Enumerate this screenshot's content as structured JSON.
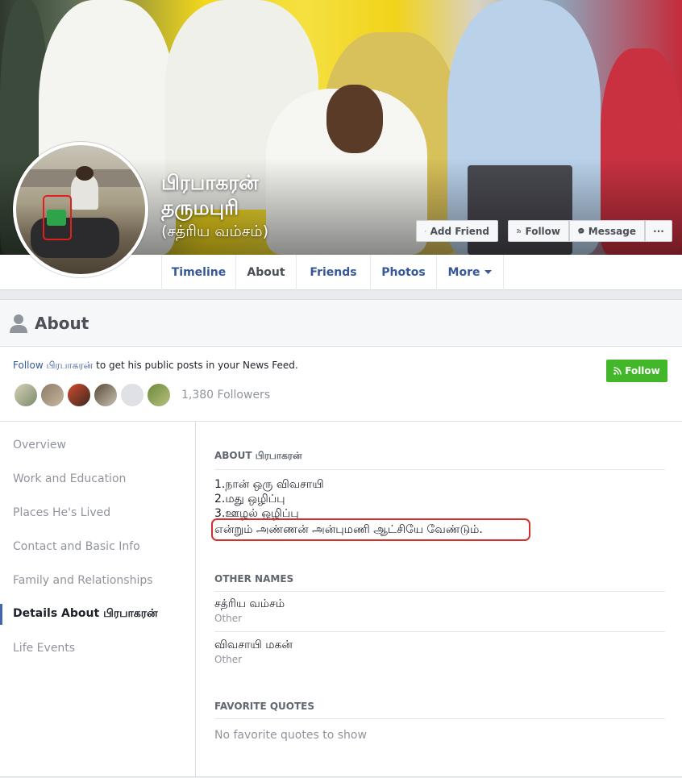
{
  "profile": {
    "name_line1": "பிரபாகரன்",
    "name_line2": "தருமபுரி",
    "name_line3": "(சத்ரிய வம்சம்)"
  },
  "cover_buttons": {
    "add_friend": "Add Friend",
    "follow": "Follow",
    "message": "Message",
    "more": "···"
  },
  "tabs": [
    {
      "label": "Timeline"
    },
    {
      "label": "About"
    },
    {
      "label": "Friends"
    },
    {
      "label": "Photos"
    },
    {
      "label": "More"
    }
  ],
  "about_header": {
    "title": "About",
    "follow_link": "Follow பிரபாகரன்",
    "follow_suffix": " to get his public posts in your News Feed.",
    "follow_button": "Follow",
    "followers": "1,380 Followers"
  },
  "sidebar": {
    "items": [
      {
        "label": "Overview"
      },
      {
        "label": "Work and Education"
      },
      {
        "label": "Places He's Lived"
      },
      {
        "label": "Contact and Basic Info"
      },
      {
        "label": "Family and Relationships"
      },
      {
        "label": "Details About பிரபாகரன்"
      },
      {
        "label": "Life Events"
      }
    ]
  },
  "about_section": {
    "heading": "ABOUT பிரபாகரன்",
    "lines": [
      "1.நான் ஒரு விவசாயி",
      "2.மது ஒழிப்பு",
      "3.ஊழல் ஒழிப்பு",
      "என்றும் அண்ணன் அன்புமணி ஆட்சியே வேண்டும்."
    ]
  },
  "other_names": {
    "heading": "OTHER NAMES",
    "items": [
      {
        "name": "சத்ரிய வம்சம்",
        "type": "Other"
      },
      {
        "name": "விவசாயி மகன்",
        "type": "Other"
      }
    ]
  },
  "favorite_quotes": {
    "heading": "FAVORITE QUOTES",
    "empty": "No favorite quotes to show"
  },
  "colors": {
    "link": "#365899",
    "green": "#42b72a",
    "highlight": "#d3302b"
  }
}
